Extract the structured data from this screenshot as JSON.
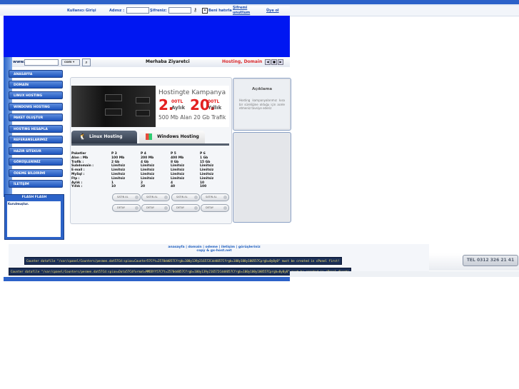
{
  "login": {
    "user_label": "Kullanıcı Girişi",
    "name_label": "Adınız :",
    "password_label": "Şifreniz:",
    "remember_label": "Beni hatırla",
    "forgot_line1": "Şifremi",
    "forgot_line2": "unuttum",
    "register_label": "Üye ol"
  },
  "search": {
    "prefix": "www.",
    "tld_value": "com"
  },
  "header": {
    "greeting": "Merhaba Ziyaretci",
    "hosting_domain": "Hosting, Domain"
  },
  "menu": [
    "ANASAYFA",
    "DOMAİN",
    "LINUX HOSTING",
    "WINDOWS HOSTING",
    "PAKET OLUŞTUR",
    "HOSTING HESAPLA",
    "REFERANSLARIMIZ",
    "HAZIR SİTEKUR",
    "GÖRÜŞLERİNİZ",
    "ÖDEME BİLDİRİMİ",
    "İLETİŞİM"
  ],
  "flash": {
    "title": "FLASH   FLASH",
    "text": "Kurulmuştur."
  },
  "campaign": {
    "title": "Hostingte Kampanya",
    "price1_big": "2.",
    "price1_small": "00TL",
    "period1": "Aylık",
    "price2_big": "20.",
    "price2_small": "00TL",
    "period2": "Yıllık",
    "line2": "500 Mb Alan 20 Gb Trafik"
  },
  "tabs": {
    "linux": "Linux Hosting",
    "windows": "Windows Hosting"
  },
  "packages": {
    "labels": [
      "Paketler",
      "Alan :  Mb",
      "Trafik :",
      "Subdomain :",
      "E-mail :",
      "MySql :",
      "Ftp :",
      "Aylık :",
      "Yıllık :"
    ],
    "columns": [
      [
        "P 3",
        "100 Mb",
        "2 Gb",
        "Limitsiz",
        "Limitsiz",
        "Limitsiz",
        "Limitsiz",
        "1",
        "10"
      ],
      [
        "P 4",
        "200 Mb",
        "4 Gb",
        "Limitsiz",
        "Limitsiz",
        "Limitsiz",
        "Limitsiz",
        "2",
        "20"
      ],
      [
        "P 5",
        "400 Mb",
        "8 Gb",
        "Limitsiz",
        "Limitsiz",
        "Limitsiz",
        "Limitsiz",
        "4",
        "40"
      ],
      [
        "P 6",
        "1 Gb",
        "15 Gb",
        "Limitsiz",
        "Limitsiz",
        "Limitsiz",
        "Limitsiz",
        "10",
        "100"
      ]
    ],
    "buy_label": "SATIN AL",
    "detail_label": "DETAY"
  },
  "aciklama": {
    "title": "Açıklama",
    "text": "Hosting kampanyalarımız kısa bir süreliğine olduğu için acele etmeniz tavsiye ederiz"
  },
  "footer": {
    "links": "anasayfa | domain | odeme | iletişim | görüşleriniz",
    "copy": "copy & gx-host.net",
    "error1": "Counter datafile \"/var/cpanel/Counters/pesmen.dat57Cd:spiax=Counter57Cft=2570dd057Cfrgb=100y139y216572Cdd4057Cfrgb=100y100y100557Cprgb=0y0y0\" must be created in cPanel first!",
    "error2": "Counter datafile \"/var/cpanel/Counters/pesmen.dat57Cd:spiax=Data57Cdformat=MMDDYY57Cft=2570dd057Cfrgb=100y139y216572Cdd4057Cfrgb=100y100y100557Cprgb=0y0y0\" must be created in cPanel first!"
  },
  "phone": "TEL 0312 326 21 41"
}
